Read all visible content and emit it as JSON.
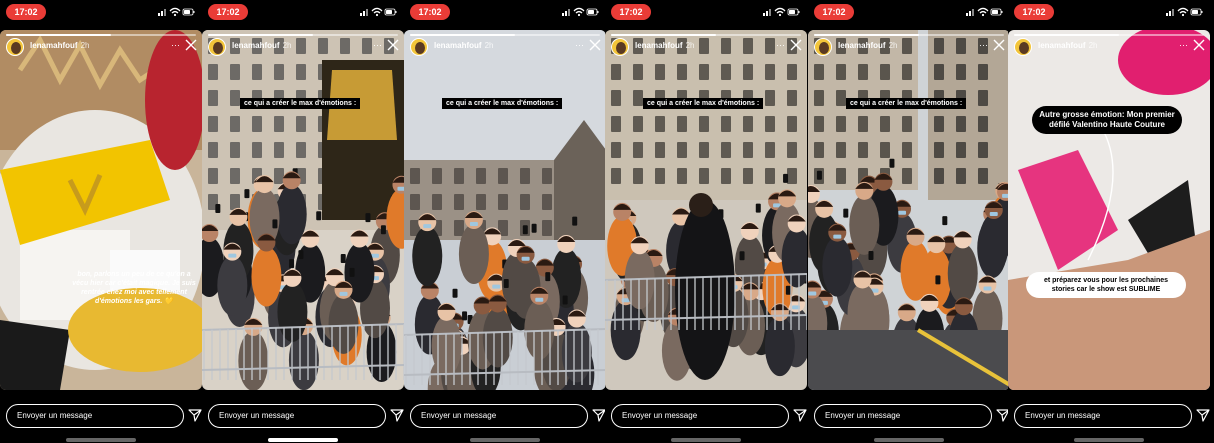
{
  "status_time": "17:02",
  "user": {
    "name": "lenamahfouf",
    "age": "2h"
  },
  "more_label": "···",
  "message_placeholder": "Envoyer un message",
  "colors": {
    "status_pill": "#ea3c37",
    "caption_bg": "#000000",
    "bubble_yellow": "#e8b931"
  },
  "stories": [
    {
      "progress": 0.55,
      "caption": "",
      "text": "bon, parlons un peu de ce qu'on a vécu hier car c'était magique. Je suis rentrée chez moi avec tellement d'émotions les gars. 💛",
      "home_active": false
    },
    {
      "progress": 0.55,
      "caption": "ce qui a créer le max d'émotions :",
      "text": "",
      "home_active": true
    },
    {
      "progress": 0.55,
      "caption": "ce qui a créer le max d'émotions :",
      "text": "",
      "home_active": false
    },
    {
      "progress": 0.55,
      "caption": "ce qui a créer le max d'émotions :",
      "text": "",
      "home_active": false
    },
    {
      "progress": 0.55,
      "caption": "ce qui a créer le max d'émotions :",
      "text": "",
      "home_active": false
    },
    {
      "progress": 0.55,
      "caption": "",
      "text": "",
      "home_active": false
    }
  ],
  "last_story": {
    "bubble_top": "Autre grosse émotion: Mon premier défilé Valentino Haute Couture",
    "bubble_bottom": "et préparez vous pour les prochaines stories car le show est SUBLIME"
  },
  "icons": {
    "wifi": "wifi-icon",
    "signal": "signal-icon",
    "battery": "battery-icon",
    "close": "close-icon",
    "send": "send-icon",
    "more": "more-icon"
  }
}
